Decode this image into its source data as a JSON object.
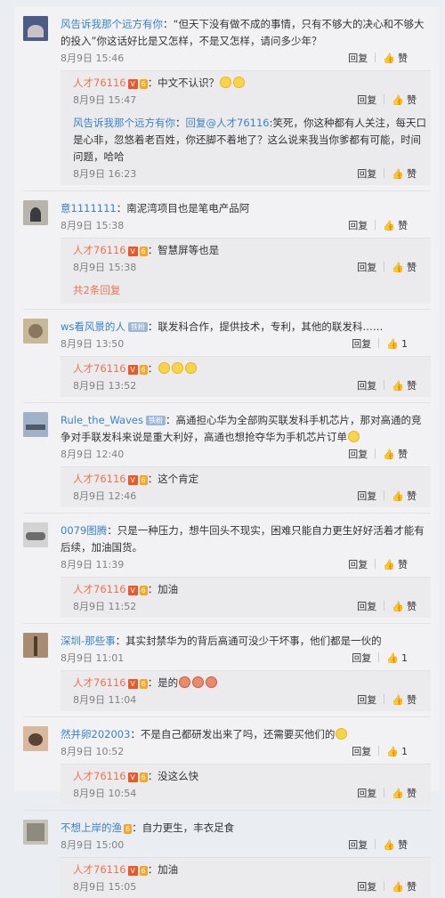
{
  "threads": [
    {
      "user": "风告诉我那个远方有你",
      "text": "：“但天下没有做不成的事情，只有不够大的决心和不够大的投入”你这话好比是又怎样，不是又怎样，请问多少年？",
      "time": "8月9日 15:46",
      "reply_label": "回复",
      "like_label": "赞",
      "replies": [
        {
          "user": "人才76116",
          "text": "：中文不认识？",
          "time": "8月9日 15:47",
          "reply_label": "回复",
          "like_label": "赞"
        },
        {
          "user": "风告诉我那个远方有你",
          "reply_to": "回复@人才76116",
          "text": ":笑死，你这种都有人关注，每天口是心非，忽悠着老百姓，你还脚不着地了？这么说来我当你爹都有可能，时间问题，哈哈",
          "time": "8月9日 16:23",
          "reply_label": "回复",
          "like_label": "赞"
        }
      ]
    },
    {
      "user": "意1111111",
      "text": "：南泥湾项目也是笔电产品阿",
      "time": "8月9日 15:38",
      "reply_label": "回复",
      "like_label": "赞",
      "replies": [
        {
          "user": "人才76116",
          "text": "：智慧屏等也是",
          "time": "8月9日 15:38",
          "reply_label": "回复",
          "like_label": "赞"
        }
      ],
      "more": "共2条回复"
    },
    {
      "user": "ws看风景的人",
      "tag": "铁粉",
      "text": "：联发科合作，提供技术，专利，其他的联发科……",
      "time": "8月9日 13:50",
      "reply_label": "回复",
      "like_label": "1",
      "replies": [
        {
          "user": "人才76116",
          "text": "：",
          "time": "8月9日 13:52",
          "reply_label": "回复",
          "like_label": "赞"
        }
      ]
    },
    {
      "user": "Rule_the_Waves",
      "tag": "铁粉",
      "text": "：高通担心华为全部购买联发科手机芯片，那对高通的竞争对手联发科来说是重大利好，高通也想抢夺华为手机芯片订单",
      "time": "8月9日 12:40",
      "reply_label": "回复",
      "like_label": "赞",
      "replies": [
        {
          "user": "人才76116",
          "text": "：这个肯定",
          "time": "8月9日 12:46",
          "reply_label": "回复",
          "like_label": "赞"
        }
      ]
    },
    {
      "user": "0079图腾",
      "text": "：只是一种压力，想牛回头不现实，困难只能自力更生好好活着才能有后续，加油国货。",
      "time": "8月9日 11:39",
      "reply_label": "回复",
      "like_label": "赞",
      "replies": [
        {
          "user": "人才76116",
          "text": "：加油",
          "time": "8月9日 11:52",
          "reply_label": "回复",
          "like_label": "赞"
        }
      ]
    },
    {
      "user": "深圳-那些事",
      "text": "：其实封禁华为的背后高通可没少干坏事，他们都是一伙的",
      "time": "8月9日 11:01",
      "reply_label": "回复",
      "like_label": "1",
      "replies": [
        {
          "user": "人才76116",
          "text": "：是的",
          "time": "8月9日 11:04",
          "reply_label": "回复",
          "like_label": "赞"
        }
      ]
    },
    {
      "user": "然并卵202003",
      "text": "：不是自己都研发出来了吗，还需要买他们的",
      "time": "8月9日 10:52",
      "reply_label": "回复",
      "like_label": "1",
      "replies": [
        {
          "user": "人才76116",
          "text": "：没这么快",
          "time": "8月9日 10:54",
          "reply_label": "回复",
          "like_label": "赞"
        }
      ]
    },
    {
      "user": "不想上岸的渔",
      "text": "：自力更生，丰衣足食",
      "time": "8月9日 15:00",
      "reply_label": "回复",
      "like_label": "赞",
      "replies": [
        {
          "user": "人才76116",
          "text": "：加油",
          "time": "8月9日 15:05",
          "reply_label": "回复",
          "like_label": "赞"
        }
      ]
    }
  ],
  "badges": {
    "v": "V",
    "lv": "6"
  },
  "colors": {
    "username": "#eb7350",
    "link": "#3b82c4"
  }
}
